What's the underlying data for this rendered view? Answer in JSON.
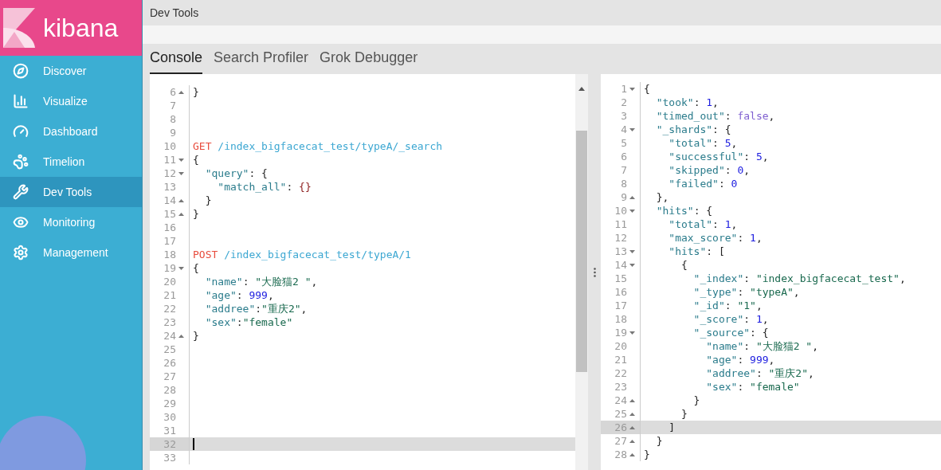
{
  "brand": {
    "name": "kibana"
  },
  "sidebar": {
    "items": [
      {
        "label": "Discover",
        "selected": false
      },
      {
        "label": "Visualize",
        "selected": false
      },
      {
        "label": "Dashboard",
        "selected": false
      },
      {
        "label": "Timelion",
        "selected": false
      },
      {
        "label": "Dev Tools",
        "selected": true
      },
      {
        "label": "Monitoring",
        "selected": false
      },
      {
        "label": "Management",
        "selected": false
      }
    ]
  },
  "header": {
    "title": "Dev Tools"
  },
  "tabs": [
    {
      "label": "Console",
      "selected": true
    },
    {
      "label": "Search Profiler",
      "selected": false
    },
    {
      "label": "Grok Debugger",
      "selected": false
    }
  ],
  "request_editor": {
    "lines": [
      {
        "num": "6",
        "kind": "close",
        "active": false,
        "tokens": [
          {
            "kind": "punct",
            "text": "}"
          }
        ]
      },
      {
        "num": "7",
        "kind": "plain",
        "active": false
      },
      {
        "num": "8",
        "kind": "plain",
        "active": false
      },
      {
        "num": "9",
        "kind": "plain",
        "active": false
      },
      {
        "num": "10",
        "kind": "plain",
        "active": false,
        "tokens": [
          {
            "kind": "method",
            "text": "GET"
          },
          {
            "kind": "url",
            "text": " /index_bigfacecat_test/typeA/_search"
          }
        ]
      },
      {
        "num": "11",
        "kind": "open",
        "active": false,
        "tokens": [
          {
            "kind": "punct",
            "text": "{"
          }
        ]
      },
      {
        "num": "12",
        "kind": "open",
        "active": false,
        "tokens": [
          {
            "kind": "key",
            "text": "  \"query\""
          },
          {
            "kind": "punct",
            "text": ": {"
          }
        ]
      },
      {
        "num": "13",
        "kind": "plain",
        "active": false,
        "tokens": [
          {
            "kind": "key",
            "text": "    \"match_all\""
          },
          {
            "kind": "punct",
            "text": ": "
          },
          {
            "kind": "brace",
            "text": "{}"
          }
        ]
      },
      {
        "num": "14",
        "kind": "close",
        "active": false,
        "tokens": [
          {
            "kind": "punct",
            "text": "  }"
          }
        ]
      },
      {
        "num": "15",
        "kind": "close",
        "active": false,
        "tokens": [
          {
            "kind": "punct",
            "text": "}"
          }
        ]
      },
      {
        "num": "16",
        "kind": "plain",
        "active": false
      },
      {
        "num": "17",
        "kind": "plain",
        "active": false
      },
      {
        "num": "18",
        "kind": "plain",
        "active": false,
        "tokens": [
          {
            "kind": "method",
            "text": "POST"
          },
          {
            "kind": "url",
            "text": " /index_bigfacecat_test/typeA/1"
          }
        ]
      },
      {
        "num": "19",
        "kind": "open",
        "active": false,
        "tokens": [
          {
            "kind": "punct",
            "text": "{"
          }
        ]
      },
      {
        "num": "20",
        "kind": "plain",
        "active": false,
        "tokens": [
          {
            "kind": "key",
            "text": "  \"name\""
          },
          {
            "kind": "punct",
            "text": ": "
          },
          {
            "kind": "string",
            "text": "\"大脸猫2 \""
          },
          {
            "kind": "punct",
            "text": ","
          }
        ]
      },
      {
        "num": "21",
        "kind": "plain",
        "active": false,
        "tokens": [
          {
            "kind": "key",
            "text": "  \"age\""
          },
          {
            "kind": "punct",
            "text": ": "
          },
          {
            "kind": "number",
            "text": "999"
          },
          {
            "kind": "punct",
            "text": ","
          }
        ]
      },
      {
        "num": "22",
        "kind": "plain",
        "active": false,
        "tokens": [
          {
            "kind": "key",
            "text": "  \"addree\""
          },
          {
            "kind": "punct",
            "text": ":"
          },
          {
            "kind": "string",
            "text": "\"重庆2\""
          },
          {
            "kind": "punct",
            "text": ","
          }
        ]
      },
      {
        "num": "23",
        "kind": "plain",
        "active": false,
        "tokens": [
          {
            "kind": "key",
            "text": "  \"sex\""
          },
          {
            "kind": "punct",
            "text": ":"
          },
          {
            "kind": "string",
            "text": "\"female\""
          }
        ]
      },
      {
        "num": "24",
        "kind": "close",
        "active": false,
        "tokens": [
          {
            "kind": "punct",
            "text": "}"
          }
        ]
      },
      {
        "num": "25",
        "kind": "plain",
        "active": false
      },
      {
        "num": "26",
        "kind": "plain",
        "active": false
      },
      {
        "num": "27",
        "kind": "plain",
        "active": false
      },
      {
        "num": "28",
        "kind": "plain",
        "active": false
      },
      {
        "num": "29",
        "kind": "plain",
        "active": false
      },
      {
        "num": "30",
        "kind": "plain",
        "active": false
      },
      {
        "num": "31",
        "kind": "plain",
        "active": false
      },
      {
        "num": "32",
        "kind": "plain",
        "active": true
      },
      {
        "num": "33",
        "kind": "plain",
        "active": false
      }
    ]
  },
  "response_editor": {
    "lines": [
      {
        "num": "1",
        "kind": "open",
        "active": false,
        "tokens": [
          {
            "kind": "punct",
            "text": "{"
          }
        ]
      },
      {
        "num": "2",
        "kind": "plain",
        "active": false,
        "tokens": [
          {
            "kind": "key",
            "text": "  \"took\""
          },
          {
            "kind": "punct",
            "text": ": "
          },
          {
            "kind": "number",
            "text": "1"
          },
          {
            "kind": "punct",
            "text": ","
          }
        ]
      },
      {
        "num": "3",
        "kind": "plain",
        "active": false,
        "tokens": [
          {
            "kind": "key",
            "text": "  \"timed_out\""
          },
          {
            "kind": "punct",
            "text": ": "
          },
          {
            "kind": "bool",
            "text": "false"
          },
          {
            "kind": "punct",
            "text": ","
          }
        ]
      },
      {
        "num": "4",
        "kind": "open",
        "active": false,
        "tokens": [
          {
            "kind": "key",
            "text": "  \"_shards\""
          },
          {
            "kind": "punct",
            "text": ": {"
          }
        ]
      },
      {
        "num": "5",
        "kind": "plain",
        "active": false,
        "tokens": [
          {
            "kind": "key",
            "text": "    \"total\""
          },
          {
            "kind": "punct",
            "text": ": "
          },
          {
            "kind": "number",
            "text": "5"
          },
          {
            "kind": "punct",
            "text": ","
          }
        ]
      },
      {
        "num": "6",
        "kind": "plain",
        "active": false,
        "tokens": [
          {
            "kind": "key",
            "text": "    \"successful\""
          },
          {
            "kind": "punct",
            "text": ": "
          },
          {
            "kind": "number",
            "text": "5"
          },
          {
            "kind": "punct",
            "text": ","
          }
        ]
      },
      {
        "num": "7",
        "kind": "plain",
        "active": false,
        "tokens": [
          {
            "kind": "key",
            "text": "    \"skipped\""
          },
          {
            "kind": "punct",
            "text": ": "
          },
          {
            "kind": "number",
            "text": "0"
          },
          {
            "kind": "punct",
            "text": ","
          }
        ]
      },
      {
        "num": "8",
        "kind": "plain",
        "active": false,
        "tokens": [
          {
            "kind": "key",
            "text": "    \"failed\""
          },
          {
            "kind": "punct",
            "text": ": "
          },
          {
            "kind": "number",
            "text": "0"
          }
        ]
      },
      {
        "num": "9",
        "kind": "close",
        "active": false,
        "tokens": [
          {
            "kind": "punct",
            "text": "  },"
          }
        ]
      },
      {
        "num": "10",
        "kind": "open",
        "active": false,
        "tokens": [
          {
            "kind": "key",
            "text": "  \"hits\""
          },
          {
            "kind": "punct",
            "text": ": {"
          }
        ]
      },
      {
        "num": "11",
        "kind": "plain",
        "active": false,
        "tokens": [
          {
            "kind": "key",
            "text": "    \"total\""
          },
          {
            "kind": "punct",
            "text": ": "
          },
          {
            "kind": "number",
            "text": "1"
          },
          {
            "kind": "punct",
            "text": ","
          }
        ]
      },
      {
        "num": "12",
        "kind": "plain",
        "active": false,
        "tokens": [
          {
            "kind": "key",
            "text": "    \"max_score\""
          },
          {
            "kind": "punct",
            "text": ": "
          },
          {
            "kind": "number",
            "text": "1"
          },
          {
            "kind": "punct",
            "text": ","
          }
        ]
      },
      {
        "num": "13",
        "kind": "open",
        "active": false,
        "tokens": [
          {
            "kind": "key",
            "text": "    \"hits\""
          },
          {
            "kind": "punct",
            "text": ": ["
          }
        ]
      },
      {
        "num": "14",
        "kind": "open",
        "active": false,
        "tokens": [
          {
            "kind": "punct",
            "text": "      {"
          }
        ]
      },
      {
        "num": "15",
        "kind": "plain",
        "active": false,
        "tokens": [
          {
            "kind": "key",
            "text": "        \"_index\""
          },
          {
            "kind": "punct",
            "text": ": "
          },
          {
            "kind": "string",
            "text": "\"index_bigfacecat_test\""
          },
          {
            "kind": "punct",
            "text": ","
          }
        ]
      },
      {
        "num": "16",
        "kind": "plain",
        "active": false,
        "tokens": [
          {
            "kind": "key",
            "text": "        \"_type\""
          },
          {
            "kind": "punct",
            "text": ": "
          },
          {
            "kind": "string",
            "text": "\"typeA\""
          },
          {
            "kind": "punct",
            "text": ","
          }
        ]
      },
      {
        "num": "17",
        "kind": "plain",
        "active": false,
        "tokens": [
          {
            "kind": "key",
            "text": "        \"_id\""
          },
          {
            "kind": "punct",
            "text": ": "
          },
          {
            "kind": "string",
            "text": "\"1\""
          },
          {
            "kind": "punct",
            "text": ","
          }
        ]
      },
      {
        "num": "18",
        "kind": "plain",
        "active": false,
        "tokens": [
          {
            "kind": "key",
            "text": "        \"_score\""
          },
          {
            "kind": "punct",
            "text": ": "
          },
          {
            "kind": "number",
            "text": "1"
          },
          {
            "kind": "punct",
            "text": ","
          }
        ]
      },
      {
        "num": "19",
        "kind": "open",
        "active": false,
        "tokens": [
          {
            "kind": "key",
            "text": "        \"_source\""
          },
          {
            "kind": "punct",
            "text": ": {"
          }
        ]
      },
      {
        "num": "20",
        "kind": "plain",
        "active": false,
        "tokens": [
          {
            "kind": "key",
            "text": "          \"name\""
          },
          {
            "kind": "punct",
            "text": ": "
          },
          {
            "kind": "string",
            "text": "\"大脸猫2 \""
          },
          {
            "kind": "punct",
            "text": ","
          }
        ]
      },
      {
        "num": "21",
        "kind": "plain",
        "active": false,
        "tokens": [
          {
            "kind": "key",
            "text": "          \"age\""
          },
          {
            "kind": "punct",
            "text": ": "
          },
          {
            "kind": "number",
            "text": "999"
          },
          {
            "kind": "punct",
            "text": ","
          }
        ]
      },
      {
        "num": "22",
        "kind": "plain",
        "active": false,
        "tokens": [
          {
            "kind": "key",
            "text": "          \"addree\""
          },
          {
            "kind": "punct",
            "text": ": "
          },
          {
            "kind": "string",
            "text": "\"重庆2\""
          },
          {
            "kind": "punct",
            "text": ","
          }
        ]
      },
      {
        "num": "23",
        "kind": "plain",
        "active": false,
        "tokens": [
          {
            "kind": "key",
            "text": "          \"sex\""
          },
          {
            "kind": "punct",
            "text": ": "
          },
          {
            "kind": "string",
            "text": "\"female\""
          }
        ]
      },
      {
        "num": "24",
        "kind": "close",
        "active": false,
        "tokens": [
          {
            "kind": "punct",
            "text": "        }"
          }
        ]
      },
      {
        "num": "25",
        "kind": "close",
        "active": false,
        "tokens": [
          {
            "kind": "punct",
            "text": "      }"
          }
        ]
      },
      {
        "num": "26",
        "kind": "close",
        "active": true,
        "tokens": [
          {
            "kind": "punct",
            "text": "    ]"
          }
        ]
      },
      {
        "num": "27",
        "kind": "close",
        "active": false,
        "tokens": [
          {
            "kind": "punct",
            "text": "  }"
          }
        ]
      },
      {
        "num": "28",
        "kind": "close",
        "active": false,
        "tokens": [
          {
            "kind": "punct",
            "text": "}"
          }
        ]
      }
    ]
  }
}
